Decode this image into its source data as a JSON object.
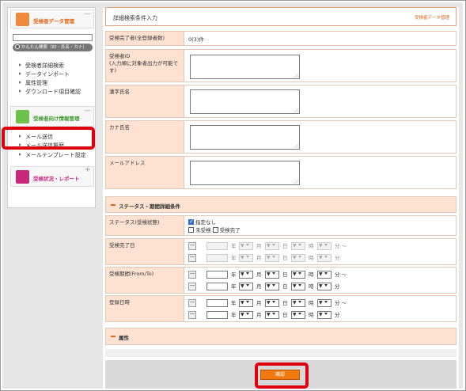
{
  "sidebar": {
    "data_mgmt": {
      "title": "受検者データ管理",
      "search_button": "かんたん検索（ID・氏名・カナ）",
      "links": [
        "受検者詳細検索",
        "データインポート",
        "属性管理",
        "ダウンロード項目確認"
      ]
    },
    "info_mgmt": {
      "title": "受検者向け情報管理",
      "links": [
        "メール送信",
        "メール送信履歴",
        "メールテンプレート設定"
      ]
    },
    "report": {
      "title": "受検状況・レポート"
    },
    "accent_colors": {
      "data_icon": "#f08a3c",
      "info_icon": "#6cc24a",
      "report_icon": "#c7287a"
    }
  },
  "main": {
    "title": "詳細検索条件入力",
    "title_right": "受検者データ管理",
    "completed_label": "受検完了者(全登録者数)",
    "completed_value": "0(3)件",
    "id_label": "受検者ID\n(入力順に対象者出力が可能です)",
    "kanji_label": "漢字氏名",
    "kana_label": "カナ氏名",
    "email_label": "メールアドレス",
    "status_section": "ステータス・期間詳細条件",
    "status_label": "ステータス(受検状態)",
    "status_opt_all": "指定なし",
    "status_opt_not": "未受検",
    "status_opt_done": "受検完了",
    "completed_date_label": "受検完了日",
    "period_label": "受検期間(From/To)",
    "reg_date_label": "登録日時",
    "attr_section": "属性",
    "confirm_button": "確認",
    "unit_year": "年",
    "unit_month": "月",
    "unit_day": "日",
    "unit_hour": "時",
    "unit_min": "分",
    "unit_min_tilde": "分 〜"
  }
}
